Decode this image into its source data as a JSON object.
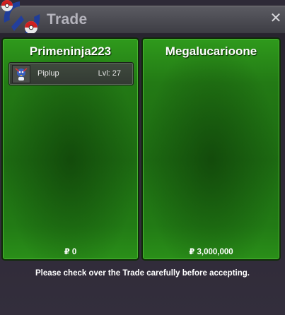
{
  "window": {
    "title": "Trade",
    "close_symbol": "✕"
  },
  "left_player": {
    "name": "Primeninja223",
    "items": [
      {
        "name": "Piplup",
        "level": "Lvl: 27"
      }
    ],
    "currency_symbol": "₽",
    "money": "0"
  },
  "right_player": {
    "name": "Megalucarioone",
    "items": [],
    "currency_symbol": "₽",
    "money": "3,000,000"
  },
  "footer": {
    "notice": "Please check over the Trade carefully before accepting."
  },
  "colors": {
    "panel_green": "#237a15",
    "background": "#2e2a37",
    "title_text": "#b4b3bc"
  }
}
